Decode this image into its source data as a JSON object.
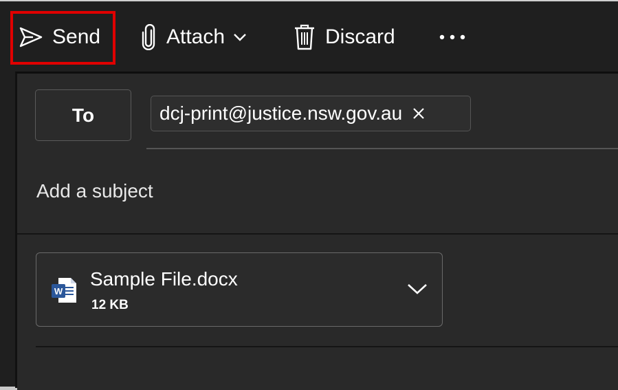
{
  "toolbar": {
    "send_label": "Send",
    "attach_label": "Attach",
    "discard_label": "Discard"
  },
  "recipients": {
    "to_label": "To",
    "chip_email": "dcj-print@justice.nsw.gov.au"
  },
  "subject": {
    "placeholder": "Add a subject"
  },
  "attachment": {
    "file_name": "Sample File.docx",
    "file_size": "12 KB"
  },
  "colors": {
    "highlight": "#e00000",
    "word_blue": "#2b579a"
  },
  "icons": {
    "send": "paper-plane-icon",
    "attach": "paperclip-icon",
    "attach_dropdown": "chevron-down-icon",
    "discard": "trash-icon",
    "more": "more-dots-icon",
    "remove_recipient": "close-icon",
    "file": "word-document-icon",
    "attachment_menu": "chevron-down-icon"
  }
}
